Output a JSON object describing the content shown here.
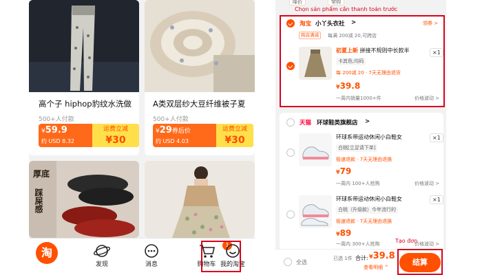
{
  "left": {
    "products": [
      {
        "title": "高个子 hiphop豹纹水洗做",
        "sold": "500+人付款",
        "price_symbol": "¥",
        "price": "59.9",
        "price_note": "",
        "usd": "约 USD 8.32",
        "promo_tag": "运费立减",
        "promo_amount": "¥30"
      },
      {
        "title": "A类双层纱大豆纤维被子夏",
        "sold": "500+人付款",
        "price_symbol": "¥",
        "price": "29",
        "price_note": "券后价",
        "usd": "约 USD 4.03",
        "promo_tag": "运费立减",
        "promo_amount": "¥30"
      },
      {
        "overlay_lines": [
          "厚底",
          "踩屎感"
        ]
      },
      {}
    ],
    "tabbar": {
      "home_logo": "淘",
      "discover": "发现",
      "messages": "消息",
      "cart": "购物车",
      "cart_badge": "1",
      "my_taobao": "我的淘宝"
    }
  },
  "right": {
    "top_chips": [
      "降价",
      "常购"
    ],
    "hint_select": "Chọn sản phẩm cần thanh toán trước",
    "shop1": {
      "brand": "淘宝",
      "name": "小丫头衣社",
      "chevron": ">",
      "coupon_link": "领券 >",
      "promo_tag": "跨店满减",
      "promo_text": "每满 200减 20,可跨店",
      "item": {
        "new_tag": "初夏上新",
        "name": "拼接不规则中长款半",
        "sku": "卡其色;均码",
        "qty": "×1",
        "promo": "每 200减 20 · 7天无理由退货",
        "price": "39.8",
        "monthly": "一周内销量1000+件",
        "price_trend": "价格波动 >"
      }
    },
    "shop2": {
      "brand": "天猫",
      "name": "环球鞋类旗舰店",
      "chevron": ">",
      "items": [
        {
          "name": "环球系带运动休闲小白鞋女",
          "sku": "白桃[立足请下单]",
          "qty": "×1",
          "promo": "极速退款 · 7天无理由退换",
          "price": "79",
          "monthly": "一周内 100+人抢购",
          "price_trend": "价格波动 >"
        },
        {
          "name": "环球系带运动休闲小白鞋女",
          "sku": "白桃（升级款）今年流行的",
          "qty": "×1",
          "promo": "极速退款 · 7天无理由退换",
          "price": "89",
          "monthly": "一周内 300+人抢购",
          "price_trend": "价格波动 >"
        }
      ]
    },
    "bottom": {
      "select_all": "全选",
      "selected_count": "已选 1件",
      "total_label": "合计:",
      "total_symbol": "¥",
      "total_value": "39.8",
      "detail_link": "查看明细 ^",
      "checkout": "结算",
      "hint_order": "Tạo đơn"
    }
  },
  "colors": {
    "accent": "#ff5000",
    "annotation_red": "#d9001b",
    "promo_yellow": "#ffe04a",
    "tmall_red": "#ff0036"
  }
}
